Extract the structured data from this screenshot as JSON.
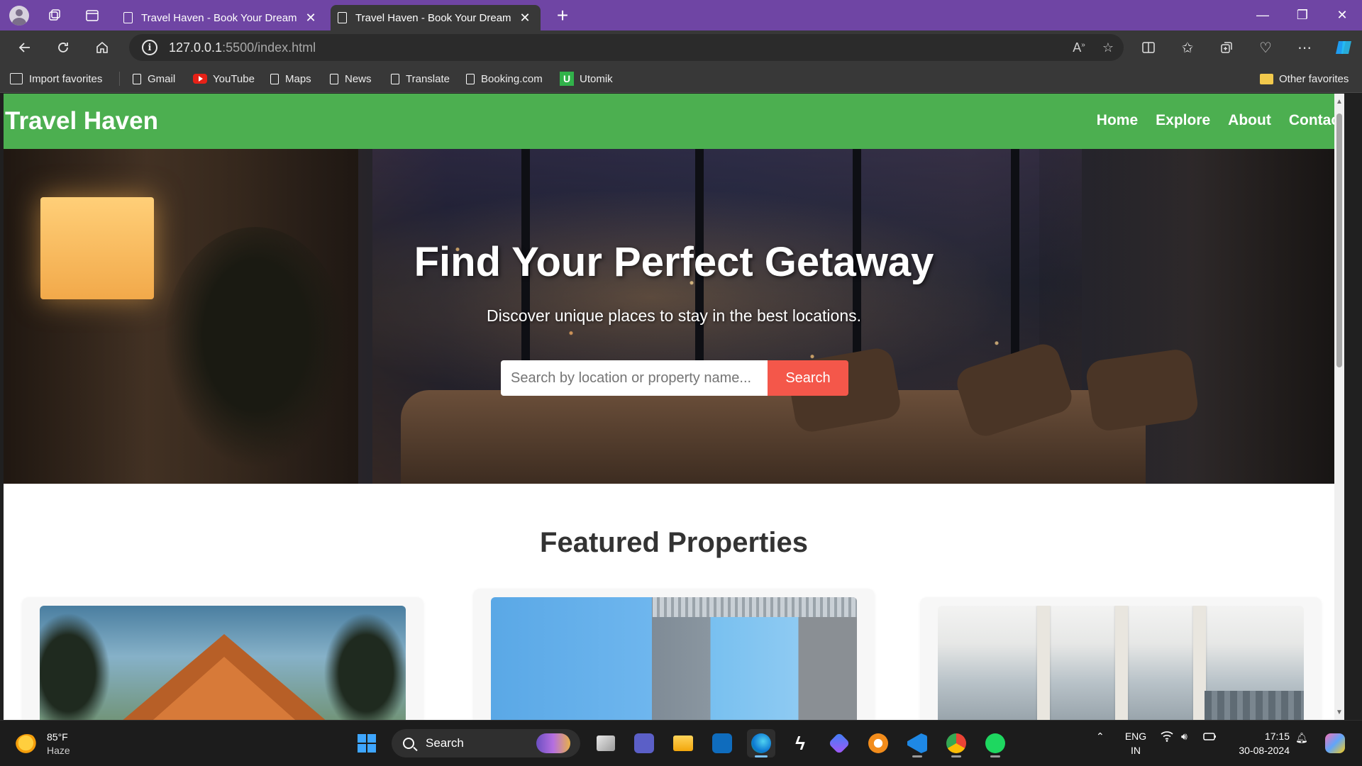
{
  "browser": {
    "tabs": [
      {
        "title": "Travel Haven - Book Your Dream Stay",
        "active": false
      },
      {
        "title": "Travel Haven - Book Your Dream Stay",
        "active": true
      }
    ],
    "new_tab_symbol": "+",
    "url_host": "127.0.0.1",
    "url_rest": ":5500/index.html",
    "favorites": {
      "import": "Import favorites",
      "items": [
        "Gmail",
        "YouTube",
        "Maps",
        "News",
        "Translate",
        "Booking.com",
        "Utomik"
      ],
      "other": "Other favorites"
    },
    "accent_color": "#6f45a4"
  },
  "site": {
    "title": "Travel Haven",
    "nav": [
      "Home",
      "Explore",
      "About",
      "Contact"
    ],
    "header_color": "#4caf50",
    "hero": {
      "title": "Find Your Perfect Getaway",
      "subtitle": "Discover unique places to stay in the best locations.",
      "search_placeholder": "Search by location or property name...",
      "search_button": "Search",
      "button_color": "#f4574a"
    },
    "featured_title": "Featured Properties",
    "cards": [
      {
        "image": "a-frame cabin among trees"
      },
      {
        "image": "modern house with ocean view"
      },
      {
        "image": "penthouse with city skyline view"
      }
    ]
  },
  "taskbar": {
    "weather_temp": "85°F",
    "weather_desc": "Haze",
    "search_label": "Search",
    "lang_top": "ENG",
    "lang_bottom": "IN",
    "time": "17:15",
    "date": "30-08-2024"
  }
}
